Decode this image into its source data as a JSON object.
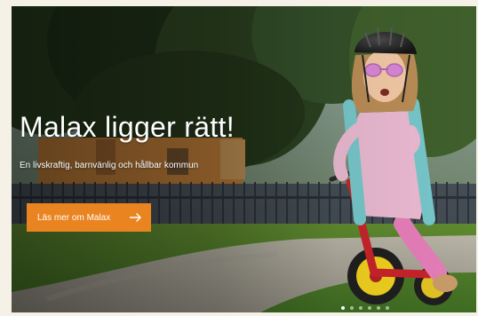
{
  "hero": {
    "title": "Malax ligger rätt!",
    "subtitle": "En livskraftig, barnvänlig och hållbar kommun",
    "cta_label": "Läs mer om Malax",
    "cta_icon": "arrow-right-icon",
    "photo": "photo-girl-balance-bike"
  },
  "carousel": {
    "slides": 6,
    "active": 1
  },
  "colors": {
    "accent": "#e98421",
    "text": "#ffffff"
  }
}
